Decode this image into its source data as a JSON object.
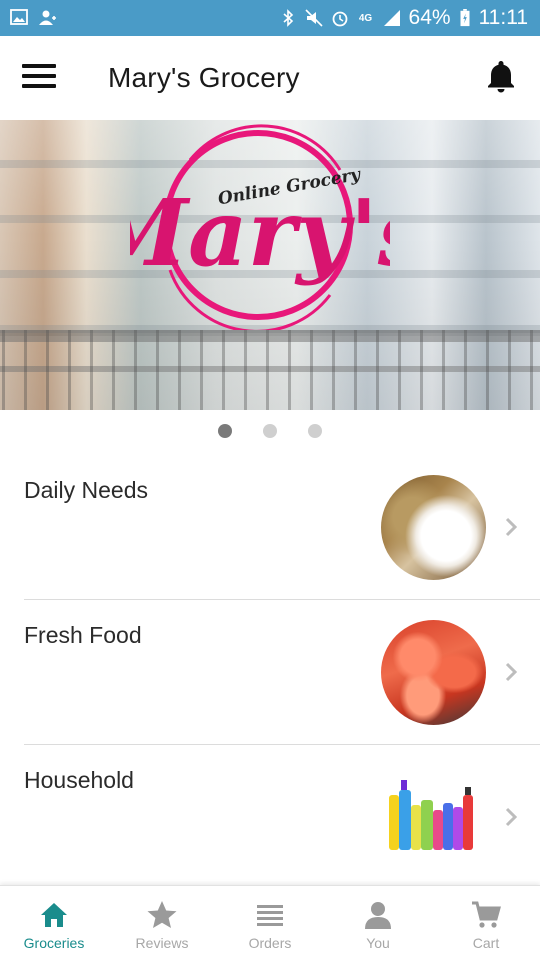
{
  "status_bar": {
    "battery": "64%",
    "time": "11:11",
    "network": "4G",
    "icons_left": [
      "image-icon",
      "person-add-icon"
    ],
    "icons_right": [
      "bluetooth-icon",
      "mute-icon",
      "alarm-icon",
      "4g-icon",
      "signal-icon",
      "battery-charging-icon"
    ]
  },
  "app_bar": {
    "title": "Mary's Grocery",
    "menu_icon": "hamburger-icon",
    "notification_icon": "bell-icon"
  },
  "banner": {
    "logo_main": "Mary's",
    "logo_tagline": "Online Grocery",
    "slides_count": 3,
    "active_slide": 0,
    "brand_color": "#e8177a"
  },
  "categories": [
    {
      "label": "Daily Needs",
      "thumb": "rice-grains"
    },
    {
      "label": "Fresh Food",
      "thumb": "fresh-fish"
    },
    {
      "label": "Household",
      "thumb": "cleaning-products"
    }
  ],
  "bottom_nav": {
    "active_color": "#1a8c8c",
    "items": [
      {
        "label": "Groceries",
        "icon": "home-icon",
        "active": true
      },
      {
        "label": "Reviews",
        "icon": "star-icon",
        "active": false
      },
      {
        "label": "Orders",
        "icon": "list-icon",
        "active": false
      },
      {
        "label": "You",
        "icon": "person-icon",
        "active": false
      },
      {
        "label": "Cart",
        "icon": "cart-icon",
        "active": false
      }
    ]
  }
}
